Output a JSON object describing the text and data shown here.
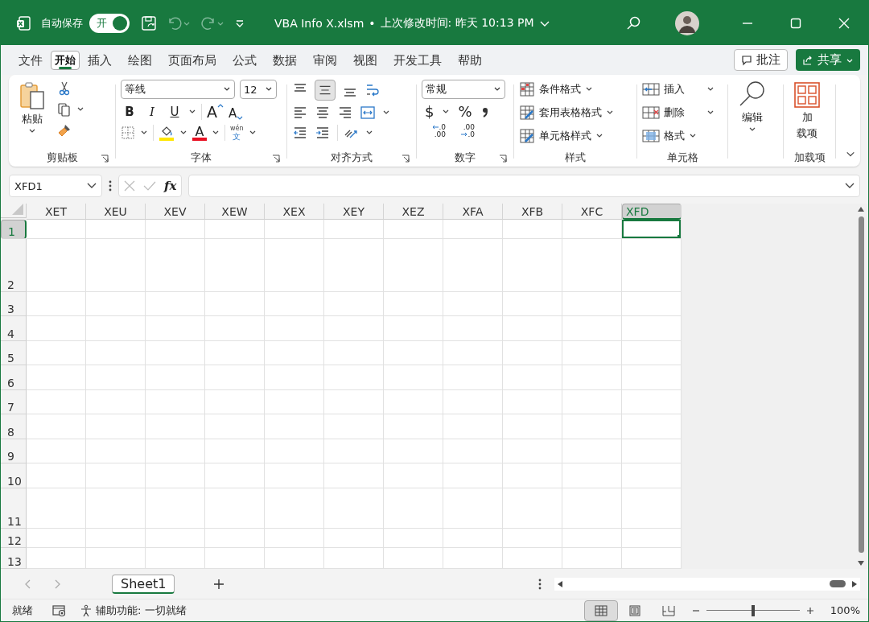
{
  "title_bar": {
    "autosave_label": "自动保存",
    "autosave_on": true,
    "autosave_state": "开",
    "file_name": "VBA Info X.xlsm",
    "separator": "•",
    "modified": "上次修改时间: 昨天 10:13 PM"
  },
  "tabs": [
    {
      "label": "文件",
      "selected": false
    },
    {
      "label": "开始",
      "selected": true
    },
    {
      "label": "插入",
      "selected": false
    },
    {
      "label": "绘图",
      "selected": false
    },
    {
      "label": "页面布局",
      "selected": false
    },
    {
      "label": "公式",
      "selected": false
    },
    {
      "label": "数据",
      "selected": false
    },
    {
      "label": "审阅",
      "selected": false
    },
    {
      "label": "视图",
      "selected": false
    },
    {
      "label": "开发工具",
      "selected": false
    },
    {
      "label": "帮助",
      "selected": false
    }
  ],
  "comments_button": "批注",
  "share_button": "共享",
  "ribbon": {
    "clipboard": {
      "label": "剪贴板",
      "paste": "粘贴"
    },
    "font": {
      "label": "字体",
      "font_name": "等线",
      "font_size": "12",
      "format_buttons": [
        {
          "kind": "bold",
          "label": "B"
        },
        {
          "kind": "italic",
          "label": "I"
        },
        {
          "kind": "underline",
          "label": "U"
        },
        {
          "kind": "grow",
          "label": "A"
        },
        {
          "kind": "shrink",
          "label": "A"
        }
      ],
      "font_color_label": "A",
      "phonetic_top": "wén",
      "phonetic_bottom": "文"
    },
    "alignment": {
      "label": "对齐方式",
      "middle_align_on": true
    },
    "number": {
      "label": "数字",
      "format": "常规",
      "currency": "$",
      "percent": "%",
      "increase_decimal": [
        ".0",
        ".00"
      ],
      "decrease_decimal": [
        ".00",
        ".0"
      ]
    },
    "styles": {
      "label": "样式",
      "items": [
        "条件格式",
        "套用表格格式",
        "单元格样式"
      ]
    },
    "cells": {
      "label": "单元格",
      "items": [
        {
          "kind": "insert",
          "label": "插入"
        },
        {
          "kind": "delete",
          "label": "删除"
        },
        {
          "kind": "format",
          "label": "格式"
        }
      ]
    },
    "editing": {
      "label": "编辑"
    },
    "addins": {
      "button_top": "加",
      "button_bottom": "载项",
      "label": "加载项"
    }
  },
  "formula_bar": {
    "name_box": "XFD1",
    "fx": "fx"
  },
  "grid": {
    "columns": [
      {
        "label": "XET",
        "selected": false
      },
      {
        "label": "XEU",
        "selected": false
      },
      {
        "label": "XEV",
        "selected": false
      },
      {
        "label": "XEW",
        "selected": false
      },
      {
        "label": "XEX",
        "selected": false
      },
      {
        "label": "XEY",
        "selected": false
      },
      {
        "label": "XEZ",
        "selected": false
      },
      {
        "label": "XFA",
        "selected": false
      },
      {
        "label": "XFB",
        "selected": false
      },
      {
        "label": "XFC",
        "selected": false
      },
      {
        "label": "XFD",
        "selected": true
      }
    ],
    "rows": [
      {
        "label": "1",
        "selected": true
      },
      {
        "label": "2",
        "selected": false
      },
      {
        "label": "3",
        "selected": false
      },
      {
        "label": "4",
        "selected": false
      },
      {
        "label": "5",
        "selected": false
      },
      {
        "label": "6",
        "selected": false
      },
      {
        "label": "7",
        "selected": false
      },
      {
        "label": "8",
        "selected": false
      },
      {
        "label": "9",
        "selected": false
      },
      {
        "label": "10",
        "selected": false
      },
      {
        "label": "11",
        "selected": false
      },
      {
        "label": "12",
        "selected": false
      },
      {
        "label": "13",
        "selected": false
      }
    ]
  },
  "sheet_tabs": [
    {
      "label": "Sheet1",
      "selected": true
    }
  ],
  "status_bar": {
    "status": "就绪",
    "accessibility": "辅助功能: 一切就绪",
    "views": [
      {
        "kind": "normal",
        "selected": true
      },
      {
        "kind": "page_layout",
        "selected": false
      },
      {
        "kind": "page_break",
        "selected": false
      }
    ],
    "zoom_level": {
      "level": 0.5
    },
    "zoom": "100%"
  }
}
